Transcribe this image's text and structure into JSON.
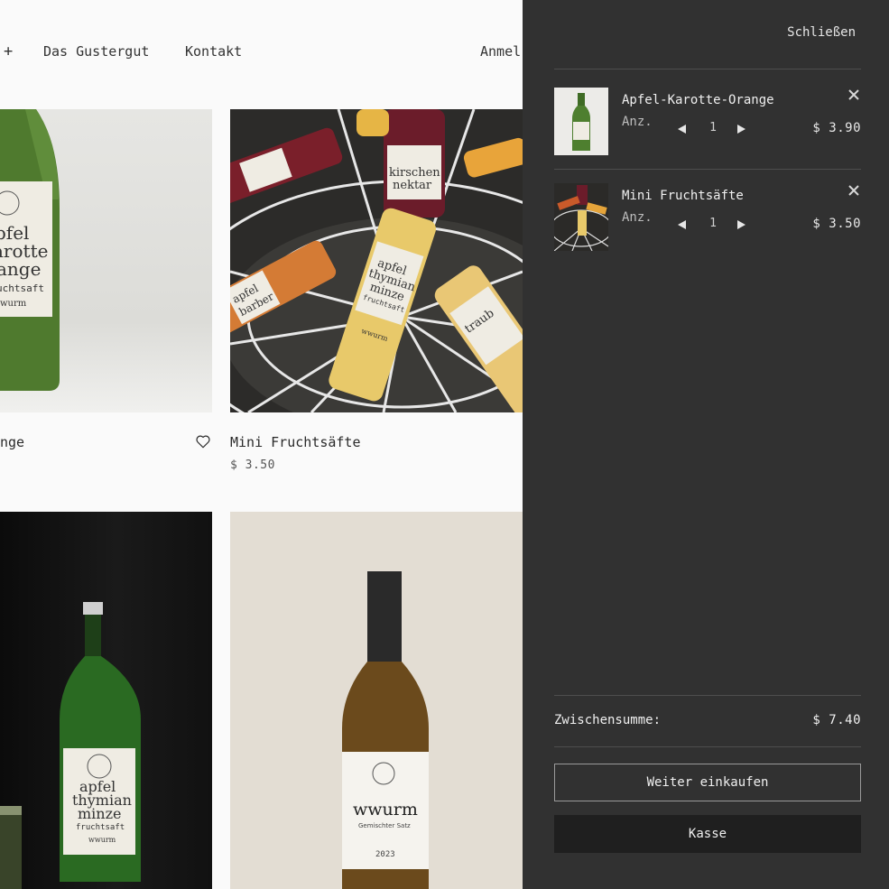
{
  "nav": {
    "plus_label": "+",
    "items": [
      "Das Gustergut",
      "Kontakt"
    ],
    "login_partial": "Anmel"
  },
  "products": [
    {
      "name_partial": "nge",
      "image_text": [
        "pfel",
        "arotte",
        "ange",
        "uchtsaft",
        "wurm"
      ]
    },
    {
      "name": "Mini Fruchtsäfte",
      "price": "$ 3.50",
      "image_text": [
        "kirschen",
        "nektar",
        "apfel",
        "thymian",
        "minze",
        "fruchtsaft",
        "wwurm",
        "apfel",
        "barber",
        "traub"
      ]
    },
    {
      "image_text": [
        "apfel",
        "thymian",
        "minze",
        "fruchtsaft",
        "wwurm"
      ]
    },
    {
      "image_text": [
        "wwurm",
        "Gemischter Satz",
        "2023"
      ]
    }
  ],
  "cart": {
    "close_label": "Schließen",
    "qty_label": "Anz.",
    "items": [
      {
        "title": "Apfel-Karotte-Orange",
        "qty": "1",
        "price": "$ 3.90"
      },
      {
        "title": "Mini Fruchtsäfte",
        "qty": "1",
        "price": "$ 3.50"
      }
    ],
    "subtotal_label": "Zwischensumme:",
    "subtotal_value": "$ 7.40",
    "continue_label": "Weiter einkaufen",
    "checkout_label": "Kasse"
  },
  "colors": {
    "drawer_bg": "#313131",
    "checkout_bg": "#1f1f1f",
    "page_bg": "#fafafa"
  },
  "icons": [
    "plus-icon",
    "heart-icon",
    "close-icon",
    "arrow-left-icon",
    "arrow-right-icon"
  ]
}
